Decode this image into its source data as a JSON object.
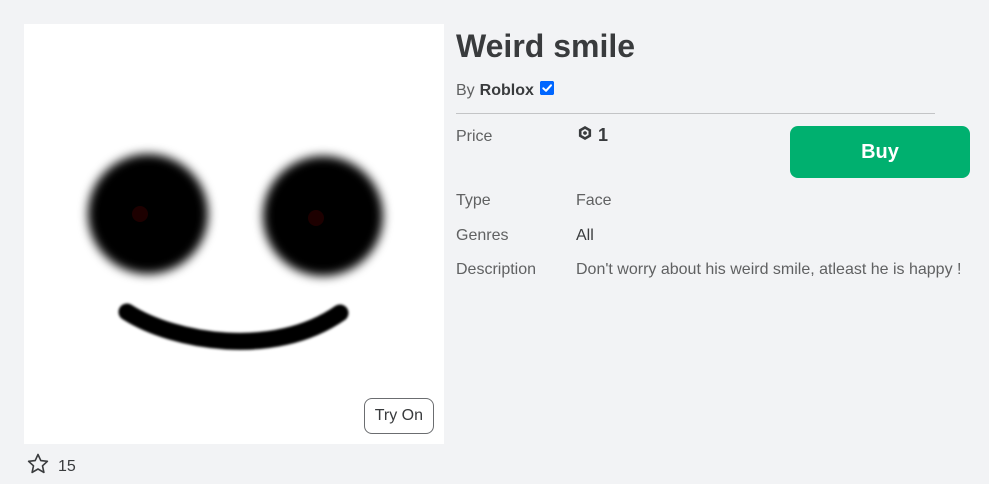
{
  "item": {
    "title": "Weird smile",
    "creator_prefix": "By",
    "creator_name": "Roblox",
    "verified_icon": "verified-badge-icon"
  },
  "thumbnail": {
    "try_on_label": "Try On"
  },
  "favorites": {
    "icon": "star-outline-icon",
    "count": "15"
  },
  "details": {
    "price_label": "Price",
    "price_icon": "robux-icon",
    "price_value": "1",
    "buy_label": "Buy",
    "type_label": "Type",
    "type_value": "Face",
    "genres_label": "Genres",
    "genres_value": "All",
    "description_label": "Description",
    "description_value": "Don't worry about his weird smile, atleast he is happy !"
  },
  "colors": {
    "buy_button": "#00b06f",
    "verified": "#0066ff",
    "page_bg": "#f2f3f5"
  }
}
